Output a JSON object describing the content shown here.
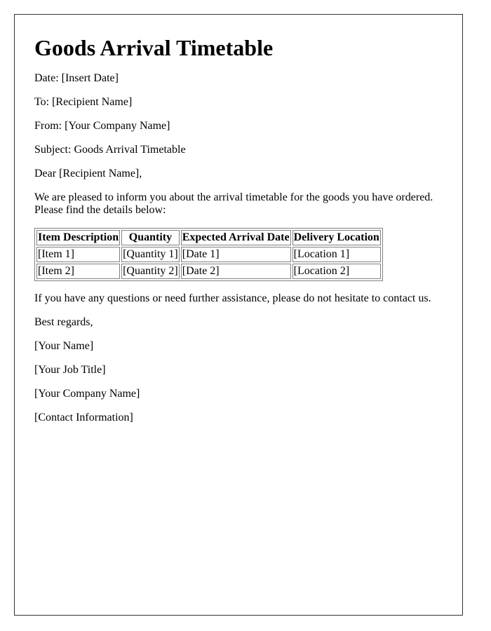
{
  "document": {
    "title": "Goods Arrival Timetable",
    "date_line": "Date: [Insert Date]",
    "to_line": "To: [Recipient Name]",
    "from_line": "From: [Your Company Name]",
    "subject_line": "Subject: Goods Arrival Timetable",
    "salutation": "Dear [Recipient Name],",
    "intro": "We are pleased to inform you about the arrival timetable for the goods you have ordered. Please find the details below:",
    "table": {
      "headers": [
        "Item Description",
        "Quantity",
        "Expected Arrival Date",
        "Delivery Location"
      ],
      "rows": [
        [
          "[Item 1]",
          "[Quantity 1]",
          "[Date 1]",
          "[Location 1]"
        ],
        [
          "[Item 2]",
          "[Quantity 2]",
          "[Date 2]",
          "[Location 2]"
        ]
      ]
    },
    "closing_note": "If you have any questions or need further assistance, please do not hesitate to contact us.",
    "sign_off": "Best regards,",
    "signature": {
      "name": "[Your Name]",
      "job_title": "[Your Job Title]",
      "company": "[Your Company Name]",
      "contact": "[Contact Information]"
    }
  }
}
